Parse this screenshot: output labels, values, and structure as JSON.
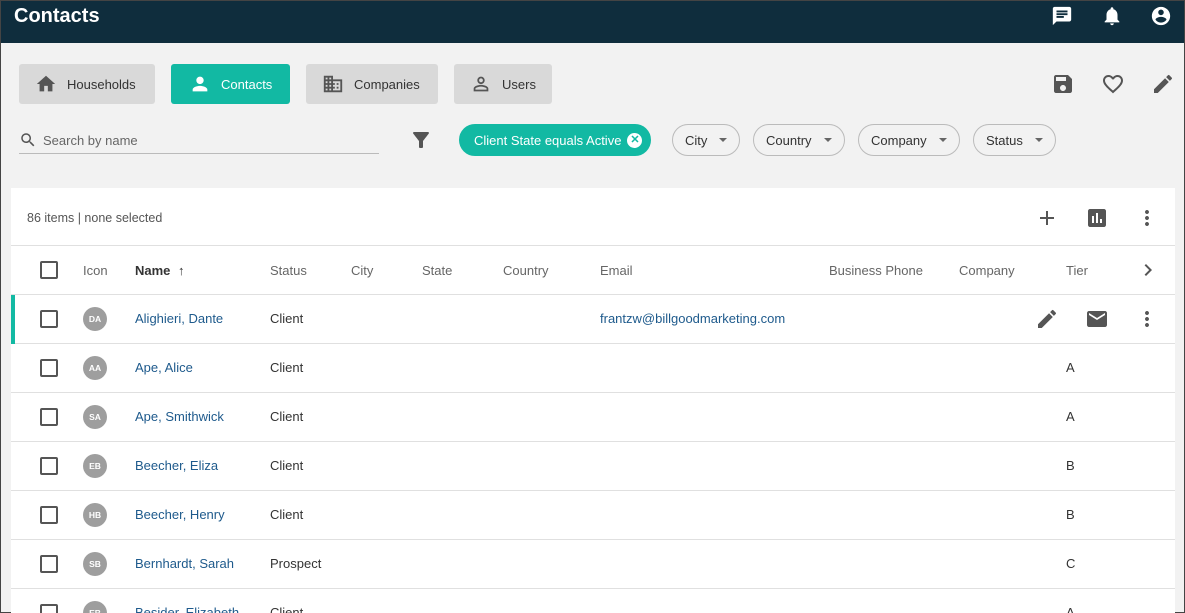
{
  "app": {
    "title": "Contacts"
  },
  "nav": {
    "households": "Households",
    "contacts": "Contacts",
    "companies": "Companies",
    "users": "Users"
  },
  "search": {
    "placeholder": "Search by name"
  },
  "filters": {
    "active_chip": "Client State equals Active",
    "city": "City",
    "country": "Country",
    "company": "Company",
    "status": "Status"
  },
  "list": {
    "count_text": "86 items | none selected"
  },
  "columns": {
    "icon": "Icon",
    "name": "Name",
    "sort_arrow": "↑",
    "status": "Status",
    "city": "City",
    "state": "State",
    "country": "Country",
    "email": "Email",
    "business_phone": "Business Phone",
    "company": "Company",
    "tier": "Tier"
  },
  "rows": [
    {
      "initials": "DA",
      "name": "Alighieri, Dante",
      "status": "Client",
      "email": "frantzw@billgoodmarketing.com",
      "tier": ""
    },
    {
      "initials": "AA",
      "name": "Ape, Alice",
      "status": "Client",
      "email": "",
      "tier": "A"
    },
    {
      "initials": "SA",
      "name": "Ape, Smithwick",
      "status": "Client",
      "email": "",
      "tier": "A"
    },
    {
      "initials": "EB",
      "name": "Beecher, Eliza",
      "status": "Client",
      "email": "",
      "tier": "B"
    },
    {
      "initials": "HB",
      "name": "Beecher, Henry",
      "status": "Client",
      "email": "",
      "tier": "B"
    },
    {
      "initials": "SB",
      "name": "Bernhardt, Sarah",
      "status": "Prospect",
      "email": "",
      "tier": "C"
    },
    {
      "initials": "EB",
      "name": "Besider, Elizabeth",
      "status": "Client",
      "email": "",
      "tier": "A"
    }
  ],
  "colors": {
    "header_bg": "#0f2d3d",
    "accent": "#12b9a3",
    "link": "#1e5a8c"
  }
}
